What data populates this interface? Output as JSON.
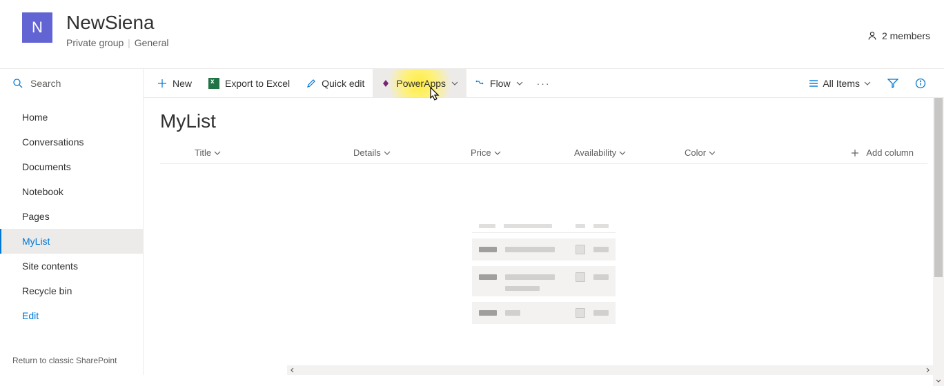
{
  "header": {
    "logo_letter": "N",
    "site_title": "NewSiena",
    "privacy": "Private group",
    "classification": "General",
    "members_label": "2 members"
  },
  "search": {
    "placeholder": "Search"
  },
  "nav": {
    "items": [
      {
        "label": "Home",
        "selected": false,
        "link": false
      },
      {
        "label": "Conversations",
        "selected": false,
        "link": false
      },
      {
        "label": "Documents",
        "selected": false,
        "link": false
      },
      {
        "label": "Notebook",
        "selected": false,
        "link": false
      },
      {
        "label": "Pages",
        "selected": false,
        "link": false
      },
      {
        "label": "MyList",
        "selected": true,
        "link": false
      },
      {
        "label": "Site contents",
        "selected": false,
        "link": false
      },
      {
        "label": "Recycle bin",
        "selected": false,
        "link": false
      },
      {
        "label": "Edit",
        "selected": false,
        "link": true
      }
    ],
    "return_link": "Return to classic SharePoint"
  },
  "commands": {
    "new": "New",
    "export": "Export to Excel",
    "quickedit": "Quick edit",
    "powerapps": "PowerApps",
    "flow": "Flow",
    "view": "All Items"
  },
  "list": {
    "title": "MyList",
    "columns": {
      "title": "Title",
      "details": "Details",
      "price": "Price",
      "availability": "Availability",
      "color": "Color",
      "add": "Add column"
    }
  }
}
